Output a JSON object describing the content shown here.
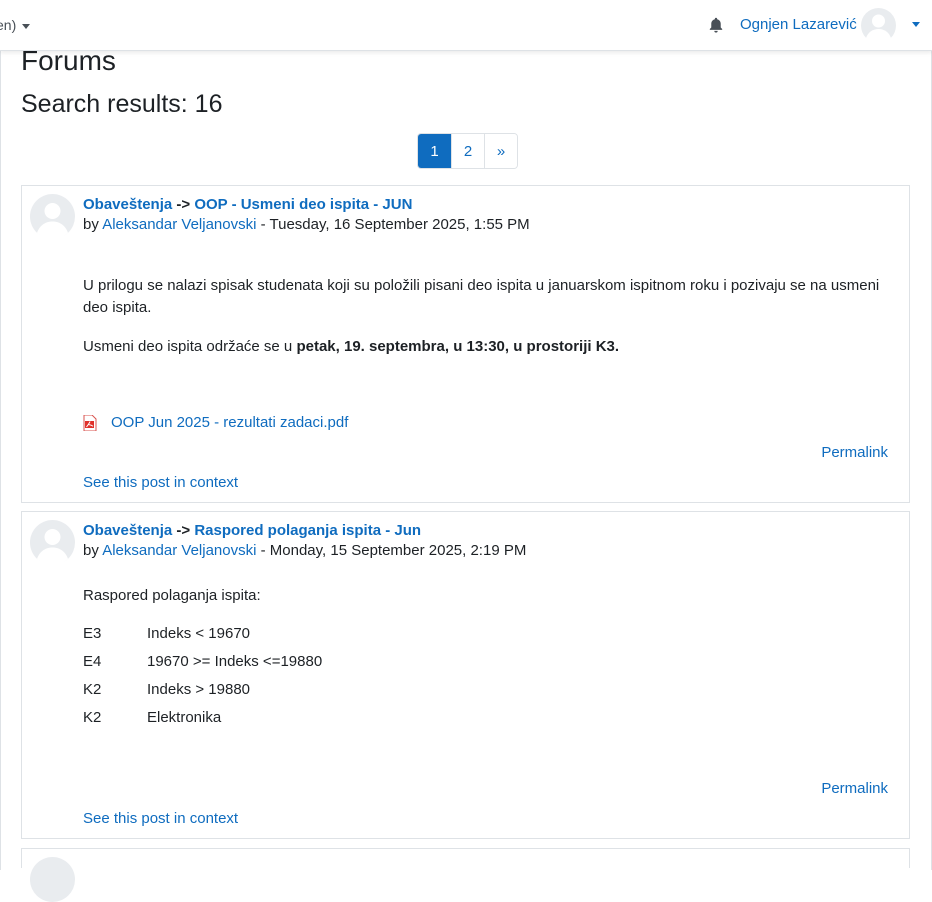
{
  "navbar": {
    "language_label": "en)",
    "user_name": "Ognjen Lazarević"
  },
  "page": {
    "title": "Forums",
    "search_results": "Search results: 16"
  },
  "pagination": [
    "1",
    "2",
    "»"
  ],
  "posts": [
    {
      "forum": "Obaveštenja",
      "arrow": "->",
      "subject": "OOP - Usmeni deo ispita - JUN",
      "by_label": "by",
      "author": "Aleksandar Veljanovski",
      "date": " - Tuesday, 16 September 2025, 1:55 PM",
      "paragraph1": "U prilogu se nalazi spisak studenata koji su položili pisani deo ispita u januarskom ispitnom roku i pozivaju se na usmeni deo ispita.",
      "paragraph2_prefix": "Usmeni deo ispita održaće se u ",
      "paragraph2_bold": "petak, 19. septembra, u 13:30, u prostoriji K3.",
      "attachment": "OOP Jun 2025 - rezultati zadaci.pdf",
      "permalink": "Permalink",
      "context_link": "See this post in context"
    },
    {
      "forum": "Obaveštenja",
      "arrow": "->",
      "subject": "Raspored polaganja ispita - Jun",
      "by_label": "by",
      "author": "Aleksandar Veljanovski",
      "date": " - Monday, 15 September 2025, 2:19 PM",
      "intro": "Raspored polaganja ispita:",
      "rows": [
        {
          "room": "E3",
          "range": "Indeks < 19670"
        },
        {
          "room": "E4",
          "range": "19670 >= Indeks <=19880"
        },
        {
          "room": "K2",
          "range": "Indeks > 19880"
        },
        {
          "room": "K2",
          "range": "Elektronika"
        }
      ],
      "permalink": "Permalink",
      "context_link": "See this post in context"
    }
  ],
  "icons": {
    "notification": "bell-icon",
    "avatar": "user-avatar-icon",
    "attachment": "pdf-file-icon"
  },
  "colors": {
    "link": "#0f6cbf",
    "active_page": "#0f6cbf",
    "border": "#dee2e6"
  }
}
